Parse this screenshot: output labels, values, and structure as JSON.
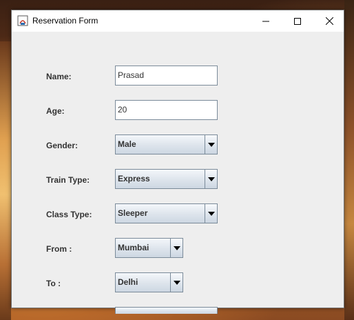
{
  "window": {
    "title": "Reservation Form",
    "controls": {
      "minimize": "minimize-icon",
      "maximize": "maximize-icon",
      "close": "close-icon"
    }
  },
  "form": {
    "name_label": "Name:",
    "name_value": "Prasad",
    "age_label": "Age:",
    "age_value": "20",
    "gender_label": "Gender:",
    "gender_value": "Male",
    "train_type_label": "Train Type:",
    "train_type_value": "Express",
    "class_type_label": "Class Type:",
    "class_type_value": "Sleeper",
    "from_label": "From :",
    "from_value": "Mumbai",
    "to_label": "To :",
    "to_value": "Delhi"
  },
  "colors": {
    "window_bg": "#eeeeee",
    "label_text": "#333333",
    "field_border": "#7a8a99"
  }
}
